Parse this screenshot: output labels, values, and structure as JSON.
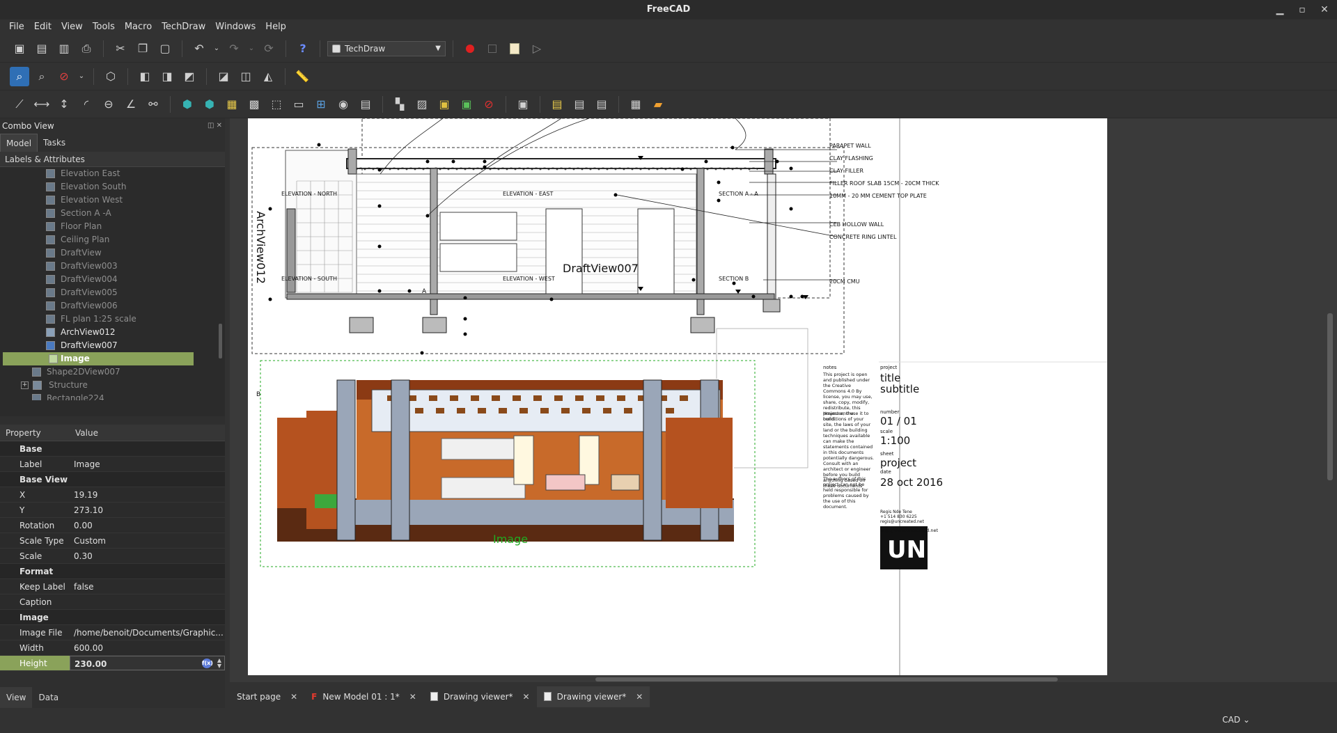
{
  "window": {
    "title": "FreeCAD",
    "minimize": "▁",
    "maximize": "▫",
    "close": "✕"
  },
  "menu": [
    "File",
    "Edit",
    "View",
    "Tools",
    "Macro",
    "TechDraw",
    "Windows",
    "Help"
  ],
  "workbench": {
    "selected": "TechDraw"
  },
  "combo": {
    "title": "Combo View",
    "tabs": [
      "Model",
      "Tasks"
    ],
    "tree_header": "Labels & Attributes",
    "tree_items": [
      {
        "label": "Elevation East",
        "visible": false
      },
      {
        "label": "Elevation South",
        "visible": false
      },
      {
        "label": "Elevation West",
        "visible": false
      },
      {
        "label": "Section A -A",
        "visible": false
      },
      {
        "label": "Floor Plan",
        "visible": false
      },
      {
        "label": "Ceiling Plan",
        "visible": false
      },
      {
        "label": "DraftView",
        "visible": false
      },
      {
        "label": "DraftView003",
        "visible": false
      },
      {
        "label": "DraftView004",
        "visible": false
      },
      {
        "label": "DraftView005",
        "visible": false
      },
      {
        "label": "DraftView006",
        "visible": false
      },
      {
        "label": "FL plan 1:25 scale",
        "visible": false
      },
      {
        "label": "ArchView012",
        "visible": true
      },
      {
        "label": "DraftView007",
        "visible": true
      },
      {
        "label": "Image",
        "visible": true,
        "selected": true
      }
    ],
    "tree_tail": {
      "shape": "Shape2DView007",
      "structure": "Structure",
      "rect": "Rectangle224"
    }
  },
  "properties": {
    "col_property": "Property",
    "col_value": "Value",
    "groups": {
      "base": "Base",
      "base_view": "Base View",
      "format": "Format",
      "image": "Image"
    },
    "label": {
      "k": "Label",
      "v": "Image"
    },
    "x": {
      "k": "X",
      "v": "19.19"
    },
    "y": {
      "k": "Y",
      "v": "273.10"
    },
    "rotation": {
      "k": "Rotation",
      "v": "0.00"
    },
    "scale_type": {
      "k": "Scale Type",
      "v": "Custom"
    },
    "scale": {
      "k": "Scale",
      "v": "0.30"
    },
    "keep_label": {
      "k": "Keep Label",
      "v": "false"
    },
    "caption": {
      "k": "Caption",
      "v": ""
    },
    "image_file": {
      "k": "Image File",
      "v": "/home/benoit/Documents/Graphic..."
    },
    "width": {
      "k": "Width",
      "v": "600.00"
    },
    "height": {
      "k": "Height",
      "v": "230.00"
    }
  },
  "bottom_tabs": [
    "View",
    "Data"
  ],
  "doc_tabs": [
    {
      "label": "Start page",
      "kind": "none"
    },
    {
      "label": "New Model 01 : 1*",
      "kind": "freecad"
    },
    {
      "label": "Drawing viewer*",
      "kind": "page"
    },
    {
      "label": "Drawing viewer*",
      "kind": "page",
      "active": true
    }
  ],
  "status": {
    "nav_style": "CAD ⌄"
  },
  "drawing": {
    "archview_label": "ArchView012",
    "draftview_label": "DraftView007",
    "image_label": "Image",
    "elev_north": "ELEVATION - NORTH",
    "elev_east": "ELEVATION - EAST",
    "section_aa": "SECTION A - A",
    "elev_south": "ELEVATION - SOUTH",
    "elev_west": "ELEVATION - WEST",
    "section_b": "SECTION B",
    "letter_a": "A",
    "letter_b": "B",
    "annotations": [
      "PARAPET WALL",
      "CLAY FLASHING",
      "CLAY FILLER",
      "FILLER ROOF SLAB 15CM - 20CM THICK",
      "10MM - 20 MM CEMENT TOP PLATE",
      "CEB HOLLOW WALL",
      "CONCRETE RING LINTEL",
      "20CM CMU"
    ]
  },
  "titleblock": {
    "notes_label": "notes",
    "notes_p1": "This project is open and published under the Creative Commons 4.0 By license, you may use, share, copy, modify, redistribute, this project and use it to build.",
    "notes_p2": "However, the conditions of your site, the laws of your land or the building techniques available can make the statements contained in this documents potentially dangerous. Consult with an architect or engineer before you build anything based on these documents",
    "notes_p3": "The authors of this project can not be held responsible for problems caused by the use of this document.",
    "project_label": "project",
    "title": "title",
    "subtitle": "subtitle",
    "number_label": "number",
    "number": "01 / 01",
    "scale_label": "scale",
    "scale": "1:100",
    "sheet_label": "sheet",
    "sheet": "project",
    "date_label": "date",
    "date": "28 oct 2016",
    "author": "Regis Nde Tene",
    "phone": "+1 514 830 6225",
    "email": "regis@uncreated.net",
    "url": "http://www.uncreated.net",
    "logo_text": "UN"
  },
  "colors": {
    "accent_selection": "#8aa25a",
    "image_frame": "#22aa22",
    "brick": "#b5521f",
    "concrete": "#9aa6b8"
  }
}
